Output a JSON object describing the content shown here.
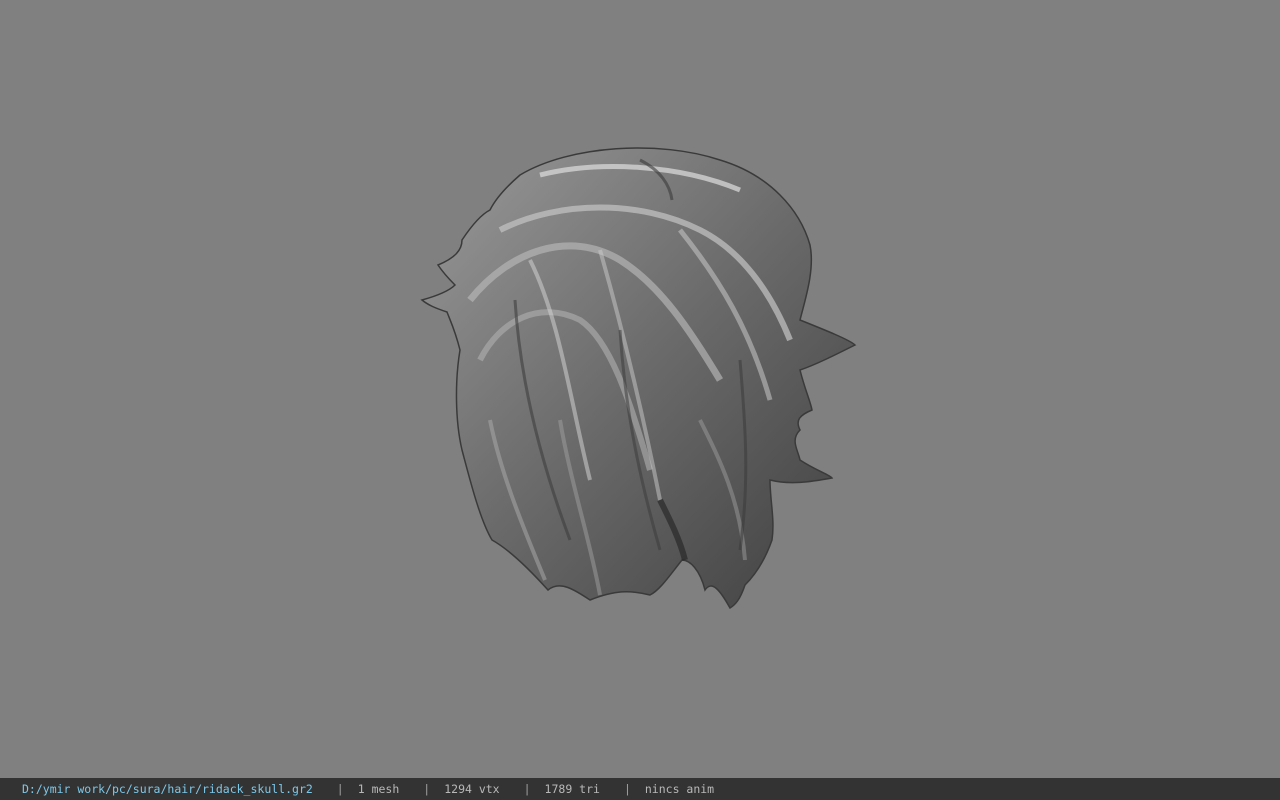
{
  "viewport": {
    "background": "#808080",
    "model": "hair-mesh"
  },
  "status_bar": {
    "file_path": "D:/ymir work/pc/sura/hair/ridack_skull.gr2",
    "separator": "|",
    "mesh_count": "1 mesh",
    "vertex_count": "1294 vtx",
    "triangle_count": "1789 tri",
    "anim_status": "nincs anim",
    "path_color": "#7ec8e8",
    "background": "#333333"
  }
}
